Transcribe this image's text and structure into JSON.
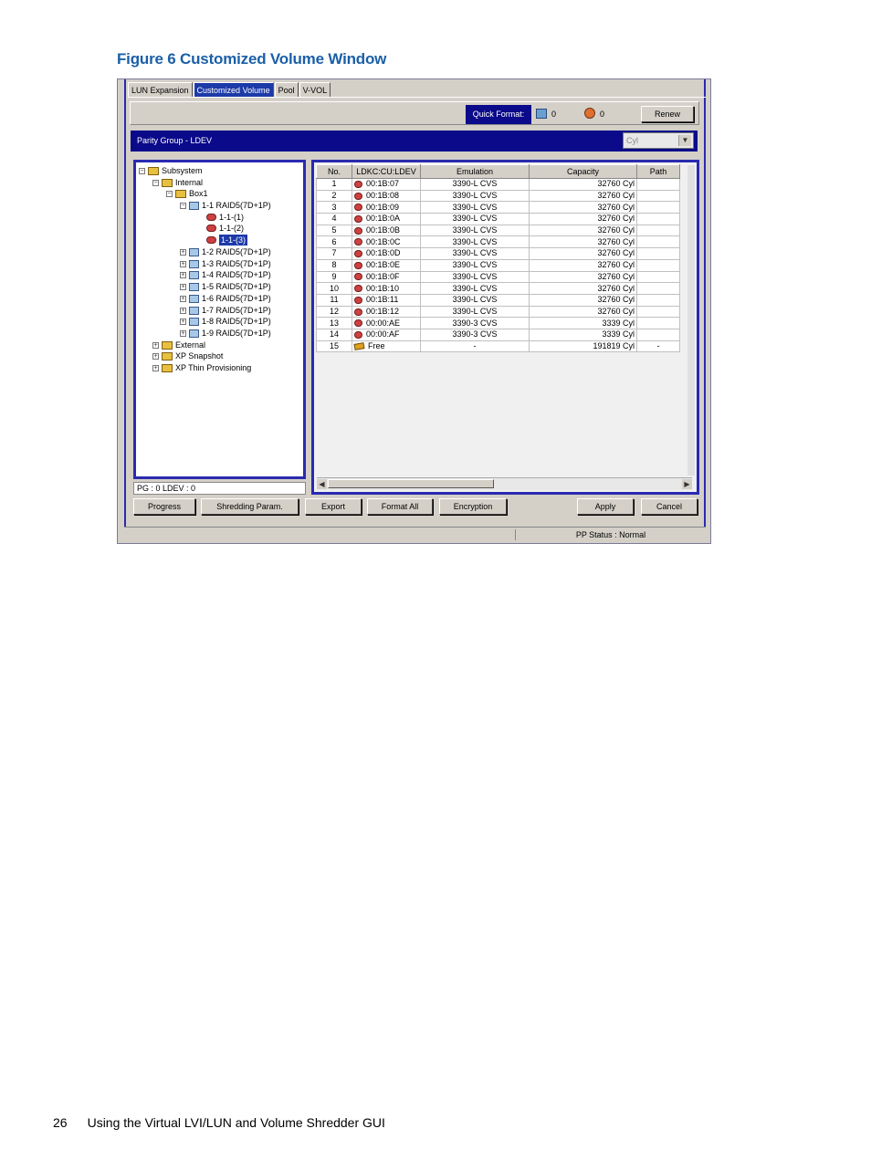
{
  "figure": {
    "caption": "Figure 6 Customized Volume Window"
  },
  "tabs": [
    {
      "label": "LUN Expansion"
    },
    {
      "label": "Customized Volume"
    },
    {
      "label": "Pool"
    },
    {
      "label": "V-VOL"
    }
  ],
  "quick_format": {
    "label": "Quick Format:",
    "count1": "0",
    "count2": "0"
  },
  "buttons": {
    "renew": "Renew",
    "progress": "Progress",
    "shredding": "Shredding Param.",
    "export": "Export",
    "format_all": "Format All",
    "encryption": "Encryption",
    "apply": "Apply",
    "cancel": "Cancel"
  },
  "parity_group_title": "Parity Group - LDEV",
  "unit_select": "Cyl",
  "tree": {
    "subsystem": "Subsystem",
    "internal": "Internal",
    "box1": "Box1",
    "groups": [
      "1-1 RAID5(7D+1P)",
      "1-2 RAID5(7D+1P)",
      "1-3 RAID5(7D+1P)",
      "1-4 RAID5(7D+1P)",
      "1-5 RAID5(7D+1P)",
      "1-6 RAID5(7D+1P)",
      "1-7 RAID5(7D+1P)",
      "1-8 RAID5(7D+1P)",
      "1-9 RAID5(7D+1P)"
    ],
    "subitems": [
      "1-1-(1)",
      "1-1-(2)",
      "1-1-(3)"
    ],
    "external": "External",
    "snapshot": "XP Snapshot",
    "thin": "XP Thin Provisioning"
  },
  "left_status": "PG : 0  LDEV : 0",
  "table": {
    "headers": [
      "No.",
      "LDKC:CU:LDEV",
      "Emulation",
      "Capacity",
      "Path"
    ],
    "rows": [
      [
        "1",
        "00:1B:07",
        "3390-L CVS",
        "32760 Cyl",
        ""
      ],
      [
        "2",
        "00:1B:08",
        "3390-L CVS",
        "32760 Cyl",
        ""
      ],
      [
        "3",
        "00:1B:09",
        "3390-L CVS",
        "32760 Cyl",
        ""
      ],
      [
        "4",
        "00:1B:0A",
        "3390-L CVS",
        "32760 Cyl",
        ""
      ],
      [
        "5",
        "00:1B:0B",
        "3390-L CVS",
        "32760 Cyl",
        ""
      ],
      [
        "6",
        "00:1B:0C",
        "3390-L CVS",
        "32760 Cyl",
        ""
      ],
      [
        "7",
        "00:1B:0D",
        "3390-L CVS",
        "32760 Cyl",
        ""
      ],
      [
        "8",
        "00:1B:0E",
        "3390-L CVS",
        "32760 Cyl",
        ""
      ],
      [
        "9",
        "00:1B:0F",
        "3390-L CVS",
        "32760 Cyl",
        ""
      ],
      [
        "10",
        "00:1B:10",
        "3390-L CVS",
        "32760 Cyl",
        ""
      ],
      [
        "11",
        "00:1B:11",
        "3390-L CVS",
        "32760 Cyl",
        ""
      ],
      [
        "12",
        "00:1B:12",
        "3390-L CVS",
        "32760 Cyl",
        ""
      ],
      [
        "13",
        "00:00:AE",
        "3390-3 CVS",
        "3339 Cyl",
        ""
      ],
      [
        "14",
        "00:00:AF",
        "3390-3 CVS",
        "3339 Cyl",
        ""
      ],
      [
        "15",
        "Free",
        "-",
        "191819 Cyl",
        "-"
      ]
    ]
  },
  "pp_status": "PP Status : Normal",
  "footer": {
    "page_number": "26",
    "title": "Using the Virtual LVI/LUN and Volume Shredder GUI"
  },
  "colors": {
    "caption": "#1a5fa8",
    "titlebar": "#0a0a8a",
    "selection": "#1c3aa8"
  }
}
